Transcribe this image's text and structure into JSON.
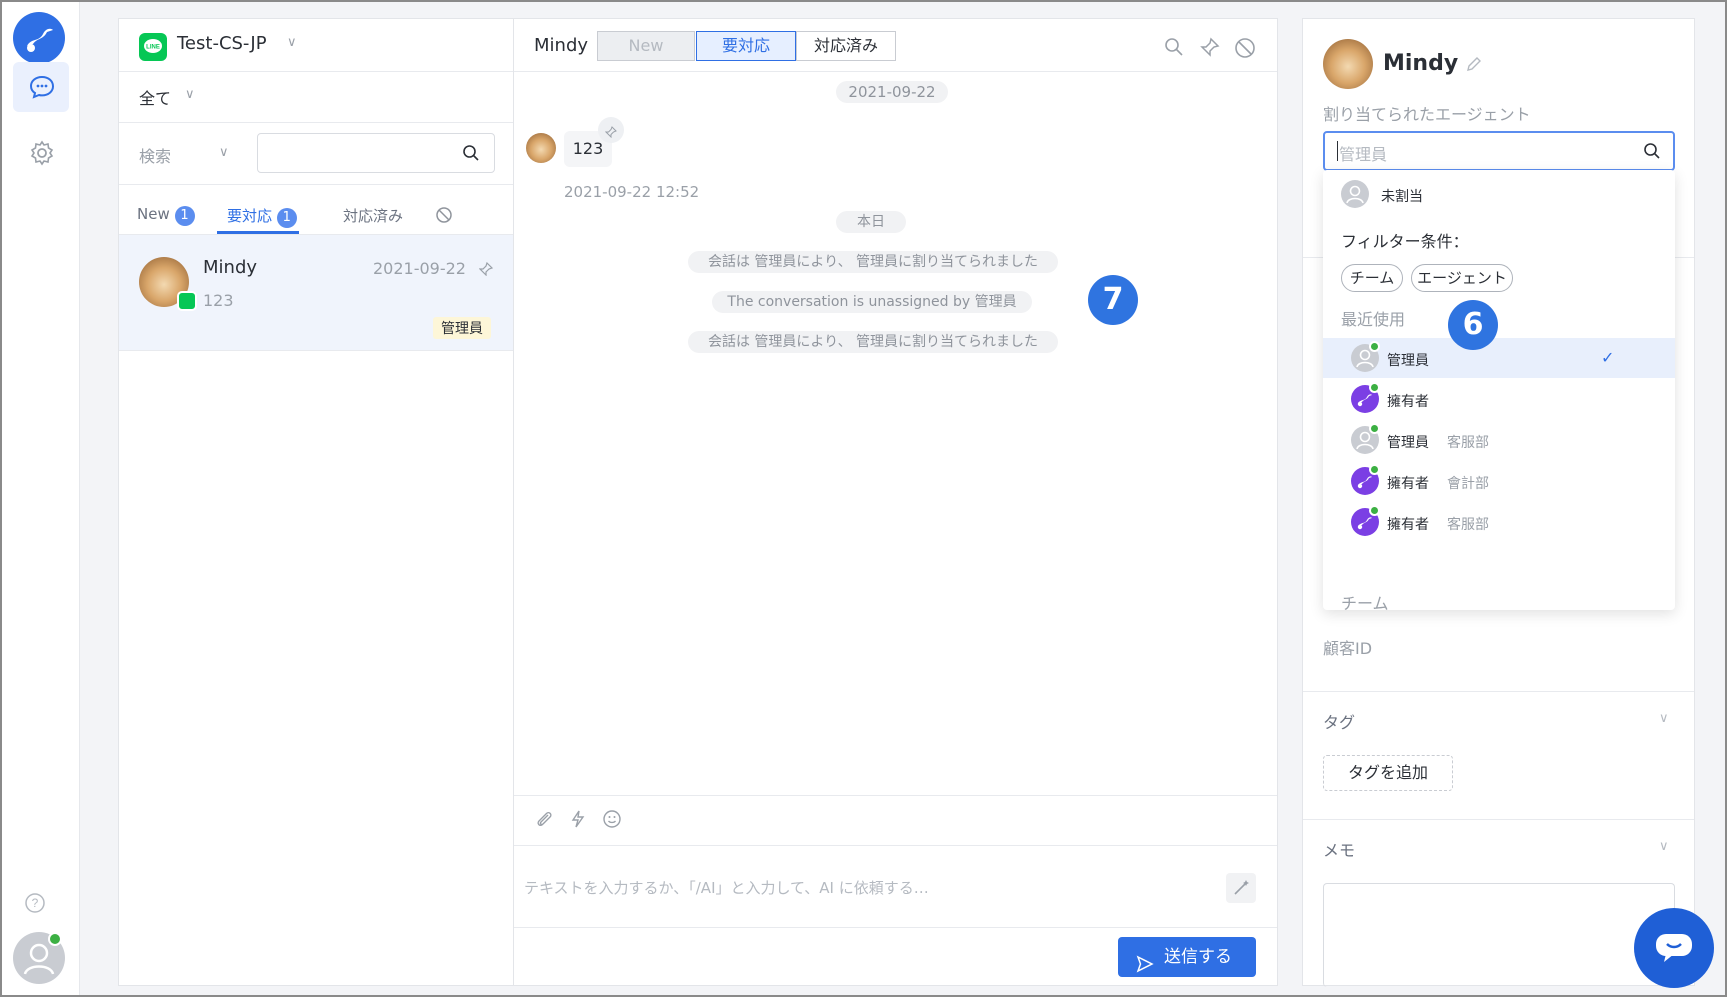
{
  "rail": {
    "logo_icon": "brand-logo-icon",
    "items": [
      {
        "icon": "chat-bubble-icon",
        "active": true
      },
      {
        "icon": "gear-icon",
        "active": false
      }
    ],
    "help_icon": "help-icon"
  },
  "list": {
    "channel_name": "Test-CS-JP",
    "filter_all": "全て",
    "search_field_label": "検索",
    "search_value": "",
    "tabs": [
      {
        "label": "New",
        "count": "1"
      },
      {
        "label": "要対応",
        "count": "1"
      },
      {
        "label": "対応済み",
        "count": ""
      }
    ],
    "conversation": {
      "name": "Mindy",
      "date": "2021-09-22",
      "preview": "123",
      "agent_tag": "管理員"
    }
  },
  "chat": {
    "customer_name": "Mindy",
    "status_options": [
      "New",
      "要対応",
      "対応済み"
    ],
    "selected_status": "要対応",
    "date_header": "2021-09-22",
    "message": {
      "text": "123",
      "time": "2021-09-22 12:52"
    },
    "today_label": "本日",
    "system_messages": [
      "会話は 管理員により、 管理員に割り当てられました",
      "The conversation is unassigned by 管理員",
      "会話は 管理員により、 管理員に割り当てられました"
    ],
    "input_placeholder": "テキストを入力するか、「/AI」と入力して、AI に依頼する…",
    "send_label": "送信する"
  },
  "profile": {
    "name": "Mindy",
    "assigned_agent_label": "割り当てられたエージェント",
    "agent_search_placeholder": "管理員",
    "unassigned_label": "未割当",
    "filter_label": "フィルター条件：",
    "filter_chips": [
      "チーム",
      "エージェント"
    ],
    "recent_label": "最近使用",
    "agents": [
      {
        "name": "管理員",
        "team": "",
        "avatar": "person",
        "selected": true
      },
      {
        "name": "擁有者",
        "team": "",
        "avatar": "brand",
        "selected": false
      },
      {
        "name": "管理員",
        "team": "客服部",
        "avatar": "person",
        "selected": false
      },
      {
        "name": "擁有者",
        "team": "會計部",
        "avatar": "brand",
        "selected": false
      },
      {
        "name": "擁有者",
        "team": "客服部",
        "avatar": "brand",
        "selected": false
      }
    ],
    "team_section_label": "チーム",
    "customer_id_label": "顧客ID",
    "tags_label": "タグ",
    "add_tag_label": "タグを追加",
    "memo_label": "メモ"
  },
  "callouts": {
    "a": "7",
    "b": "6"
  },
  "colors": {
    "accent": "#2f6fe4",
    "online": "#3cb043",
    "line_green": "#06c755",
    "tag_bg": "#fdf6d8"
  }
}
